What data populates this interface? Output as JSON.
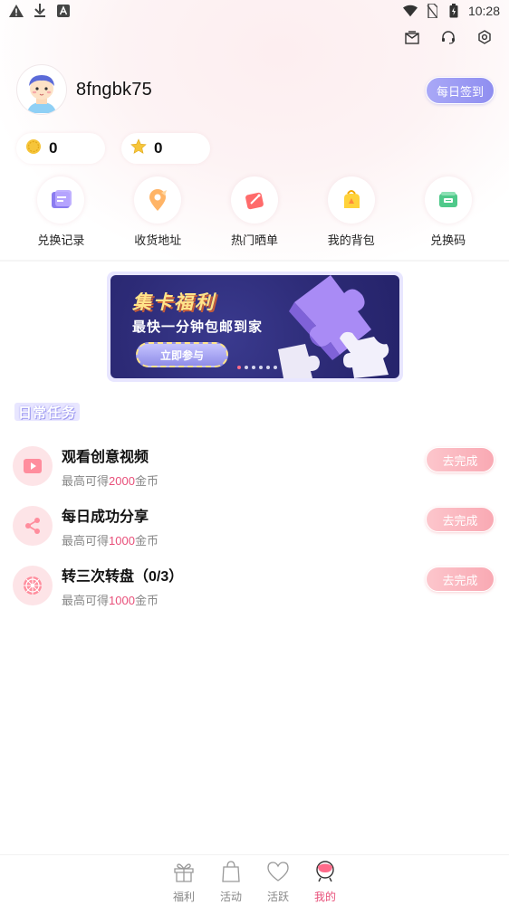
{
  "status_bar": {
    "time": "10:28",
    "left_icons": [
      "warning-icon",
      "download-icon",
      "app-a-icon"
    ],
    "right_icons": [
      "wifi-icon",
      "no-sim-icon",
      "battery-icon"
    ]
  },
  "header": {
    "icons": [
      "mail-icon",
      "headset-icon",
      "settings-icon"
    ]
  },
  "profile": {
    "username": "8fngbk75",
    "checkin_label": "每日签到"
  },
  "stats": {
    "coins": "0",
    "stars": "0"
  },
  "quick_actions": [
    {
      "label": "兑换记录",
      "icon": "exchange-record-icon"
    },
    {
      "label": "收货地址",
      "icon": "address-icon"
    },
    {
      "label": "热门晒单",
      "icon": "hot-share-icon"
    },
    {
      "label": "我的背包",
      "icon": "backpack-icon"
    },
    {
      "label": "兑换码",
      "icon": "redeem-code-icon"
    }
  ],
  "banner": {
    "title": "集卡福利",
    "subtitle": "最快一分钟包邮到家",
    "cta": "立即参与"
  },
  "daily_tasks": {
    "section_title": "日常任务",
    "tasks": [
      {
        "title": "观看创意视频",
        "sub_prefix": "最高可得",
        "amount": "2000",
        "sub_suffix": "金币",
        "button": "去完成",
        "icon": "video-icon"
      },
      {
        "title": "每日成功分享",
        "sub_prefix": "最高可得",
        "amount": "1000",
        "sub_suffix": "金币",
        "button": "去完成",
        "icon": "share-icon"
      },
      {
        "title": "转三次转盘（0/3）",
        "sub_prefix": "最高可得",
        "amount": "1000",
        "sub_suffix": "金币",
        "button": "去完成",
        "icon": "wheel-icon"
      }
    ]
  },
  "tabbar": {
    "tabs": [
      {
        "label": "福利",
        "icon": "gift-icon"
      },
      {
        "label": "活动",
        "icon": "bag-icon"
      },
      {
        "label": "活跃",
        "icon": "heart-icon"
      },
      {
        "label": "我的",
        "icon": "profile-icon",
        "active": true
      }
    ]
  },
  "colors": {
    "accent_pink": "#e8507a",
    "checkin_purple": "#8f8ef0",
    "task_button_pink": "#f9a9b3"
  }
}
